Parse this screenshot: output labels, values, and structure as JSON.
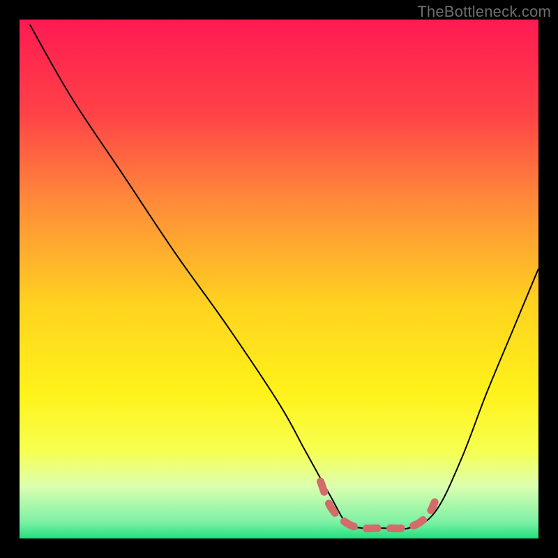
{
  "watermark": "TheBottleneck.com",
  "chart_data": {
    "type": "line",
    "title": "",
    "xlabel": "",
    "ylabel": "",
    "xlim": [
      0,
      100
    ],
    "ylim": [
      0,
      100
    ],
    "grid": false,
    "legend_position": "none",
    "series": [
      {
        "name": "bottleneck-curve",
        "x": [
          2,
          10,
          20,
          30,
          40,
          50,
          55,
          60,
          63,
          66,
          70,
          75,
          80,
          85,
          90,
          95,
          100
        ],
        "y": [
          99,
          85,
          70,
          55,
          41,
          26,
          17,
          8,
          3,
          2,
          2,
          2,
          5,
          15,
          28,
          40,
          52
        ],
        "color": "#000000",
        "stroke_width": 2
      },
      {
        "name": "optimal-highlight",
        "x": [
          58,
          60,
          63,
          66,
          70,
          74,
          77,
          79,
          80
        ],
        "y": [
          11,
          6,
          3,
          2,
          2,
          2,
          3,
          5,
          7
        ],
        "color": "#d46a6a",
        "stroke_width": 10,
        "dashed": true
      }
    ],
    "background_gradient": {
      "type": "vertical",
      "stops": [
        {
          "pos": 0.0,
          "color": "#ff1a52"
        },
        {
          "pos": 0.18,
          "color": "#ff4247"
        },
        {
          "pos": 0.35,
          "color": "#ff8a3a"
        },
        {
          "pos": 0.55,
          "color": "#ffd31f"
        },
        {
          "pos": 0.72,
          "color": "#fff21a"
        },
        {
          "pos": 0.83,
          "color": "#f7ff4f"
        },
        {
          "pos": 0.9,
          "color": "#dcffb0"
        },
        {
          "pos": 0.97,
          "color": "#7af0a4"
        },
        {
          "pos": 1.0,
          "color": "#22e07e"
        }
      ]
    }
  }
}
